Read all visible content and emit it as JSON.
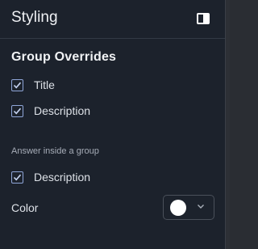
{
  "header": {
    "title": "Styling",
    "toggle_icon": "panel-toggle-icon"
  },
  "group_overrides": {
    "title": "Group Overrides",
    "items": [
      {
        "label": "Title",
        "checked": true
      },
      {
        "label": "Description",
        "checked": true
      }
    ]
  },
  "answer_group": {
    "label": "Answer inside a group",
    "items": [
      {
        "label": "Description",
        "checked": true
      }
    ]
  },
  "color": {
    "label": "Color",
    "value": "#ffffff",
    "dropdown_icon": "chevron-down-icon"
  },
  "colors": {
    "panel_bg": "#1c222c",
    "text": "#dde1e7",
    "checkbox_accent": "#8fa6d8"
  }
}
